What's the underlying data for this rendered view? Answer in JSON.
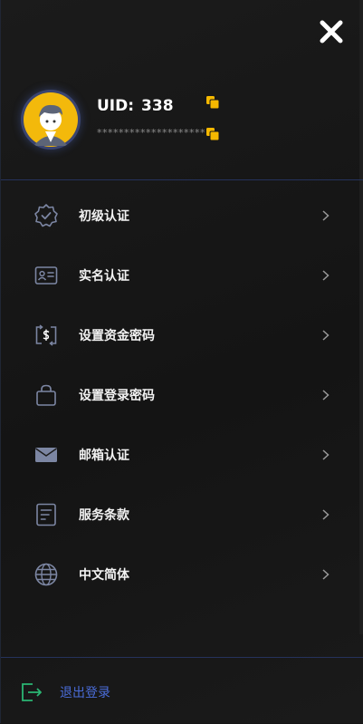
{
  "header": {
    "uid_label": "UID:",
    "uid_value": "338",
    "masked_value": "********************"
  },
  "menu": {
    "items": [
      {
        "label": "初级认证",
        "icon": "verified-badge-icon"
      },
      {
        "label": "实名认证",
        "icon": "id-card-icon"
      },
      {
        "label": "设置资金密码",
        "icon": "money-transfer-icon"
      },
      {
        "label": "设置登录密码",
        "icon": "lock-bag-icon"
      },
      {
        "label": "邮箱认证",
        "icon": "mail-icon"
      },
      {
        "label": "服务条款",
        "icon": "document-icon"
      },
      {
        "label": "中文简体",
        "icon": "globe-icon"
      }
    ]
  },
  "footer": {
    "logout_label": "退出登录"
  },
  "colors": {
    "accent_yellow": "#f5b800",
    "logout_blue": "#4a6cd8",
    "logout_icon_green": "#2bb673",
    "divider_blue": "#25325c"
  }
}
